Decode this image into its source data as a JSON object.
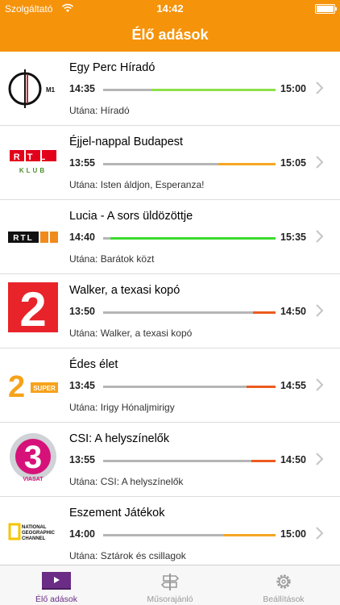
{
  "status_bar": {
    "carrier": "Szolgáltató",
    "time": "14:42"
  },
  "nav": {
    "title": "Élő adások"
  },
  "channels": [
    {
      "channel": "M1",
      "logo_text": "M1",
      "title": "Egy Perc Híradó",
      "start": "14:35",
      "end": "15:00",
      "next_label": "Utána:",
      "next": "Híradó",
      "progress": 0.72,
      "progress_color": "#8ee04a"
    },
    {
      "channel": "RTL Klub",
      "logo_text": "RTL",
      "logo_sub": "KLUB",
      "title": "Éjjel-nappal Budapest",
      "start": "13:55",
      "end": "15:05",
      "next_label": "Utána:",
      "next": "Isten áldjon, Esperanza!",
      "progress": 0.33,
      "progress_color": "#f5a623"
    },
    {
      "channel": "RTL II",
      "logo_text": "RTL",
      "title": "Lucia - A sors üldözöttje",
      "start": "14:40",
      "end": "15:35",
      "next_label": "Utána:",
      "next": "Barátok közt",
      "progress": 0.96,
      "progress_color": "#3bdc2f"
    },
    {
      "channel": "TV2",
      "logo_text": "2",
      "title": "Walker, a texasi kopó",
      "start": "13:50",
      "end": "14:50",
      "next_label": "Utána:",
      "next": "Walker, a texasi kopó",
      "progress": 0.13,
      "progress_color": "#ec5b1f"
    },
    {
      "channel": "Super TV2",
      "logo_text": "2",
      "logo_sub": "SUPER",
      "title": "Édes élet",
      "start": "13:45",
      "end": "14:55",
      "next_label": "Utána:",
      "next": "Irigy Hónaljmirigy",
      "progress": 0.17,
      "progress_color": "#ec5b1f"
    },
    {
      "channel": "Viasat 3",
      "logo_text": "3",
      "logo_sub": "VIASAT",
      "title": "CSI: A helyszínelők",
      "start": "13:55",
      "end": "14:50",
      "next_label": "Utána:",
      "next": "CSI: A helyszínelők",
      "progress": 0.14,
      "progress_color": "#ec5b1f"
    },
    {
      "channel": "National Geographic Channel",
      "logo_text": "NATIONAL GEOGRAPHIC CHANNEL",
      "title": "Eszement Játékok",
      "start": "14:00",
      "end": "15:00",
      "next_label": "Utána:",
      "next": "Sztárok és csillagok",
      "progress": 0.3,
      "progress_color": "#f5a623"
    }
  ],
  "tabs": [
    {
      "label": "Élő adások",
      "icon": "tv-icon",
      "active": true
    },
    {
      "label": "Műsorajánló",
      "icon": "signpost-icon",
      "active": false
    },
    {
      "label": "Beállítások",
      "icon": "gear-icon",
      "active": false
    }
  ],
  "colors": {
    "brand": "#f5930a",
    "active_tab": "#6a2c85"
  }
}
